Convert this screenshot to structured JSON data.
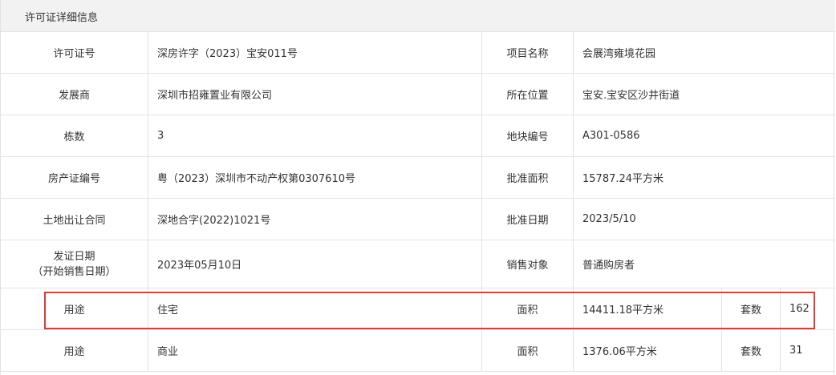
{
  "header": {
    "title": "许可证详细信息"
  },
  "rows": {
    "r1": {
      "l1": "许可证号",
      "v1": "深房许字（2023）宝安011号",
      "l2": "项目名称",
      "v2": "会展湾雍境花园"
    },
    "r2": {
      "l1": "发展商",
      "v1": "深圳市招雍置业有限公司",
      "l2": "所在位置",
      "v2": "宝安.宝安区沙井街道"
    },
    "r3": {
      "l1": "栋数",
      "v1": "3",
      "l2": "地块编号",
      "v2": "A301-0586"
    },
    "r4": {
      "l1": "房产证编号",
      "v1": "粤（2023）深圳市不动产权第0307610号",
      "l2": "批准面积",
      "v2": "15787.24平方米"
    },
    "r5": {
      "l1": "土地出让合同",
      "v1": "深地合字(2022)1021号",
      "l2": "批准日期",
      "v2": "2023/5/10"
    },
    "r6": {
      "l1a": "发证日期",
      "l1b": "（开始销售日期）",
      "v1": "2023年05月10日",
      "l2": "销售对象",
      "v2": "普通购房者"
    }
  },
  "usage_rows": [
    {
      "use_label": "用途",
      "use_value": "住宅",
      "area_label": "面积",
      "area_value": "14411.18平方米",
      "count_label": "套数",
      "count_value": "162"
    },
    {
      "use_label": "用途",
      "use_value": "商业",
      "area_label": "面积",
      "area_value": "1376.06平方米",
      "count_label": "套数",
      "count_value": "31"
    }
  ],
  "colors": {
    "border": "#e2e2e2",
    "header_bg": "#f2f2f2",
    "highlight": "#e53935",
    "text": "#333333"
  }
}
